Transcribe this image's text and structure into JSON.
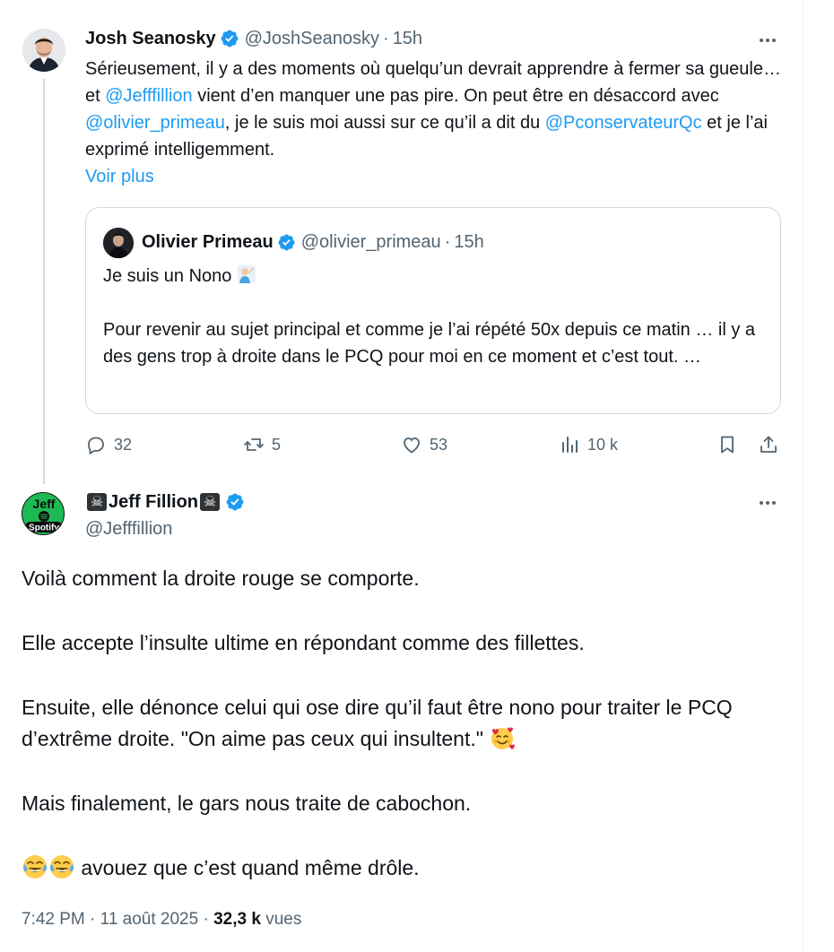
{
  "parent": {
    "author_name": "Josh Seanosky",
    "handle": "@JoshSeanosky",
    "separator": "·",
    "time": "15h",
    "text": {
      "seg1": "Sérieusement, il y a des moments où quelqu’un devrait apprendre à fermer sa gueule… et ",
      "mention1": "@Jefffillion",
      "seg2": " vient d’en manquer une pas pire. On peut être en désaccord avec ",
      "mention2": "@olivier_primeau",
      "seg3": ", je le suis moi aussi sur ce qu’il a dit du ",
      "mention3": "@PconservateurQc",
      "seg4": " et je l’ai exprimé intelligemment."
    },
    "show_more": "Voir plus",
    "quote": {
      "author_name": "Olivier Primeau",
      "handle": "@olivier_primeau",
      "separator": "·",
      "time": "15h",
      "line1": "Je suis un Nono",
      "body": "Pour revenir au sujet principal et comme je l’ai répété 50x depuis ce matin … il y a des gens trop à droite dans le PCQ pour moi en ce moment et c’est tout. …"
    },
    "actions": {
      "replies": "32",
      "reposts": "5",
      "likes": "53",
      "views": "10 k"
    }
  },
  "main": {
    "author_name": "Jeff Fillion",
    "handle": "@Jefffillion",
    "avatar_text": {
      "top": "Jeff",
      "bottom": "Spotify"
    },
    "paragraphs": [
      "Voilà comment la droite rouge se comporte.",
      "Elle accepte l’insulte ultime en répondant comme des fillettes.",
      "Ensuite, elle dénonce celui qui ose dire qu’il faut être nono pour traiter le PCQ d’extrême droite. \"On aime pas ceux qui insultent.\"",
      "Mais finalement, le gars nous traite de cabochon.",
      "avouez que c’est quand même drôle."
    ],
    "meta": {
      "time": "7:42 PM",
      "sep1": "·",
      "date": "11 août 2025",
      "sep2": "·",
      "views_count": "32,3 k",
      "views_label": "vues"
    }
  },
  "icons": {
    "verified": "verified-badge-icon",
    "more": "more-icon",
    "reply": "reply-icon",
    "repost": "repost-icon",
    "like": "heart-icon",
    "views": "views-icon",
    "bookmark": "bookmark-icon",
    "share": "share-icon",
    "skull": "skull-crossbones-icon",
    "emoji_smiling_hearts": "smiling-face-with-hearts-icon",
    "emoji_tears_of_joy": "face-with-tears-of-joy-icon",
    "emoji_person": "person-facepalming-icon"
  },
  "colors": {
    "accent": "#1d9bf0",
    "text": "#0f1419",
    "muted": "#536471",
    "border": "#cfd9de"
  }
}
